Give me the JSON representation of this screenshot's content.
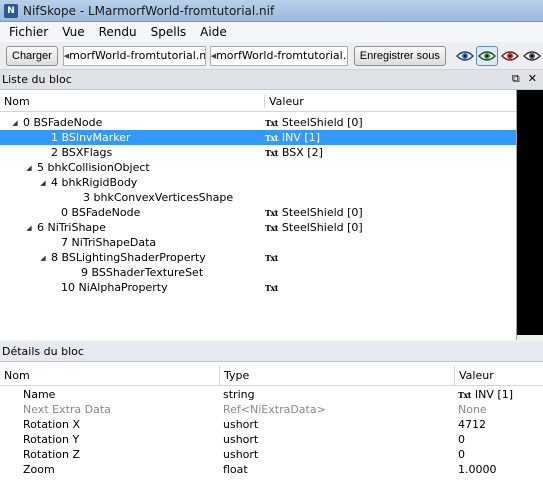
{
  "window": {
    "title": "NifSkope - LMarmorfWorld-fromtutorial.nif",
    "icon_text": "N"
  },
  "menu": [
    "Fichier",
    "Vue",
    "Rendu",
    "Spells",
    "Aide"
  ],
  "toolbar": {
    "load_label": "Charger",
    "file1_value": "morfWorld-fromtutorial.nif",
    "file2_value": "morfWorld-fromtutorial.nif",
    "save_label": "Enregistrer sous",
    "eye_icons": [
      "eye-blue-icon",
      "eye-green-icon",
      "eye-red-icon",
      "eye-dark-icon"
    ]
  },
  "block_list": {
    "title": "Liste du bloc",
    "columns": [
      "Nom",
      "Valeur"
    ],
    "rows": [
      {
        "name": "0 BSFadeNode",
        "expander": "expanded",
        "value": "SteelShield [0]",
        "badge": "Txt",
        "selected": false
      },
      {
        "name": "1 BSInvMarker",
        "expander": "none",
        "value": "INV [1]",
        "badge": "Txt",
        "selected": true
      },
      {
        "name": "2 BSXFlags",
        "expander": "none",
        "value": "BSX [2]",
        "badge": "Txt",
        "selected": false
      },
      {
        "name": "5 bhkCollisionObject",
        "expander": "expanded",
        "value": "",
        "badge": "",
        "selected": false
      },
      {
        "name": "4 bhkRigidBody",
        "expander": "expanded",
        "value": "",
        "badge": "",
        "selected": false
      },
      {
        "name": "3 bhkConvexVerticesShape",
        "expander": "none",
        "value": "",
        "badge": "",
        "selected": false
      },
      {
        "name": "0 BSFadeNode",
        "expander": "none",
        "value": "SteelShield [0]",
        "badge": "Txt",
        "selected": false
      },
      {
        "name": "6 NiTriShape",
        "expander": "expanded",
        "value": "SteelShield [0]",
        "badge": "Txt",
        "selected": false
      },
      {
        "name": "7 NiTriShapeData",
        "expander": "none",
        "value": "",
        "badge": "",
        "selected": false
      },
      {
        "name": "8 BSLightingShaderProperty",
        "expander": "expanded",
        "value": "",
        "badge": "Txt",
        "selected": false
      },
      {
        "name": "9 BSShaderTextureSet",
        "expander": "none",
        "value": "",
        "badge": "",
        "selected": false
      },
      {
        "name": "10 NiAlphaProperty",
        "expander": "none",
        "value": "",
        "badge": "Txt",
        "selected": false
      }
    ]
  },
  "block_details": {
    "title": "Détails du bloc",
    "columns": [
      "Nom",
      "Type",
      "Valeur"
    ],
    "rows": [
      {
        "name": "Name",
        "type": "string",
        "value": "INV [1]",
        "badge": "Txt",
        "muted": false
      },
      {
        "name": "Next Extra Data",
        "type": "Ref<NiExtraData>",
        "value": "None",
        "badge": "",
        "muted": true
      },
      {
        "name": "Rotation X",
        "type": "ushort",
        "value": "4712",
        "badge": "",
        "muted": false
      },
      {
        "name": "Rotation Y",
        "type": "ushort",
        "value": "0",
        "badge": "",
        "muted": false
      },
      {
        "name": "Rotation Z",
        "type": "ushort",
        "value": "0",
        "badge": "",
        "muted": false
      },
      {
        "name": "Zoom",
        "type": "float",
        "value": "1.0000",
        "badge": "",
        "muted": false
      }
    ]
  },
  "panel_icons": [
    "float-icon",
    "close-icon"
  ],
  "scrollbar": {
    "left_arrow": "◀",
    "right_arrow": "▶",
    "grip": "|||"
  }
}
